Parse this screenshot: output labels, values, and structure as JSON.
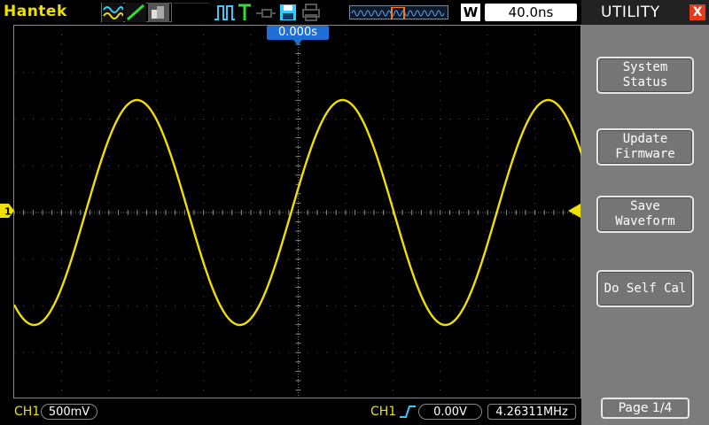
{
  "topbar": {
    "brand": "Hantek",
    "timebase_mode": "W",
    "timebase": "40.0ns",
    "icons": [
      "waveform-icon",
      "line-icon",
      "persist-icon",
      "pulse-icon",
      "trigger-T-icon",
      "probe-icon",
      "save-disk-icon",
      "printer-icon",
      "memory-overview-icon"
    ]
  },
  "screen": {
    "trigger_position": "0.000s",
    "ch1_marker": "1",
    "grid": {
      "h_divisions": 12,
      "v_divisions": 8
    },
    "trace_color": "#f0e000"
  },
  "bottombar": {
    "ch1_label": "CH1",
    "ch1_scale": "500mV",
    "trigger_source": "CH1",
    "trigger_level": "0.00V",
    "frequency": "4.26311MHz"
  },
  "menu": {
    "title": "UTILITY",
    "close": "X",
    "buttons": [
      {
        "line1": "System",
        "line2": "Status"
      },
      {
        "line1": "Update",
        "line2": "Firmware"
      },
      {
        "line1": "Save",
        "line2": "Waveform"
      },
      {
        "line1": "Do Self Cal",
        "line2": ""
      }
    ],
    "page": "Page 1/4"
  },
  "colors": {
    "accent": "#f0e000",
    "marker_blue": "#1d6fd6",
    "panel": "#7c7c7c",
    "close": "#e83a1a"
  }
}
